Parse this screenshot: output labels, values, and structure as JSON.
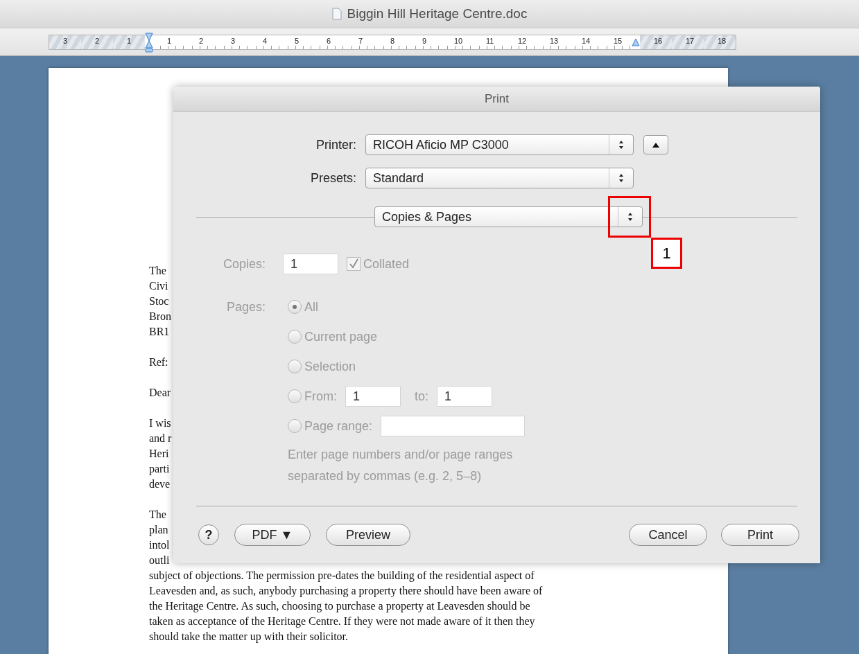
{
  "window": {
    "title": "Biggin Hill Heritage Centre.doc"
  },
  "ruler": {
    "marks": [
      {
        "label": "3",
        "margin": true
      },
      {
        "label": "2",
        "margin": true
      },
      {
        "label": "1",
        "margin": true
      },
      {
        "label": "1",
        "margin": false
      },
      {
        "label": "2",
        "margin": false
      },
      {
        "label": "3",
        "margin": false
      },
      {
        "label": "4",
        "margin": false
      },
      {
        "label": "5",
        "margin": false
      },
      {
        "label": "6",
        "margin": false
      },
      {
        "label": "7",
        "margin": false
      },
      {
        "label": "8",
        "margin": false
      },
      {
        "label": "9",
        "margin": false
      },
      {
        "label": "10",
        "margin": false
      },
      {
        "label": "11",
        "margin": false
      },
      {
        "label": "12",
        "margin": false
      },
      {
        "label": "13",
        "margin": false
      },
      {
        "label": "14",
        "margin": false
      },
      {
        "label": "15",
        "margin": false
      },
      {
        "label": "16",
        "margin": true
      },
      {
        "label": "17",
        "margin": true
      },
      {
        "label": "18",
        "margin": true
      }
    ]
  },
  "document": {
    "paragraphs": [
      {
        "lines": [
          "The",
          "Civi",
          "Stoc",
          "Bron",
          "BR1"
        ]
      },
      {
        "lines": [
          "Ref:"
        ]
      },
      {
        "lines": [
          "Dear"
        ]
      },
      {
        "lines": [
          "I wis",
          "and r",
          "Heri",
          "parti",
          "deve"
        ]
      },
      {
        "lines": [
          "The",
          "plan",
          "intol",
          "outli",
          "subject of objections. The permission pre-dates the building of the residential aspect of",
          "Leavesden and, as such, anybody purchasing a property there should have been aware of",
          "the Heritage Centre. As such, choosing to purchase a property at Leavesden should be",
          "taken as acceptance of the Heritage Centre. If they were not made aware of it then they",
          "should take the matter up with their solicitor."
        ]
      }
    ]
  },
  "dialog": {
    "title": "Print",
    "printer": {
      "label": "Printer:",
      "value": "RICOH Aficio MP C3000"
    },
    "presets": {
      "label": "Presets:",
      "value": "Standard"
    },
    "panel": {
      "value": "Copies & Pages"
    },
    "disabled": true,
    "copies": {
      "label": "Copies:",
      "value": "1",
      "collated": {
        "label": "Collated",
        "checked": true
      }
    },
    "pages": {
      "label": "Pages:",
      "options": [
        {
          "kind": "plain",
          "label": "All",
          "selected": true
        },
        {
          "kind": "plain",
          "label": "Current page",
          "selected": false
        },
        {
          "kind": "plain",
          "label": "Selection",
          "selected": false
        },
        {
          "kind": "from",
          "label": "From:",
          "selected": false
        },
        {
          "kind": "range",
          "label": "Page range:",
          "selected": false
        }
      ],
      "from_value": "1",
      "to_label": "to:",
      "to_value": "1",
      "hint": "Enter page numbers and/or page ranges separated by commas (e.g. 2, 5–8)"
    },
    "buttons": {
      "help": "?",
      "pdf": "PDF ▼",
      "preview": "Preview",
      "cancel": "Cancel",
      "print": "Print"
    }
  },
  "callout": {
    "label": "1"
  }
}
